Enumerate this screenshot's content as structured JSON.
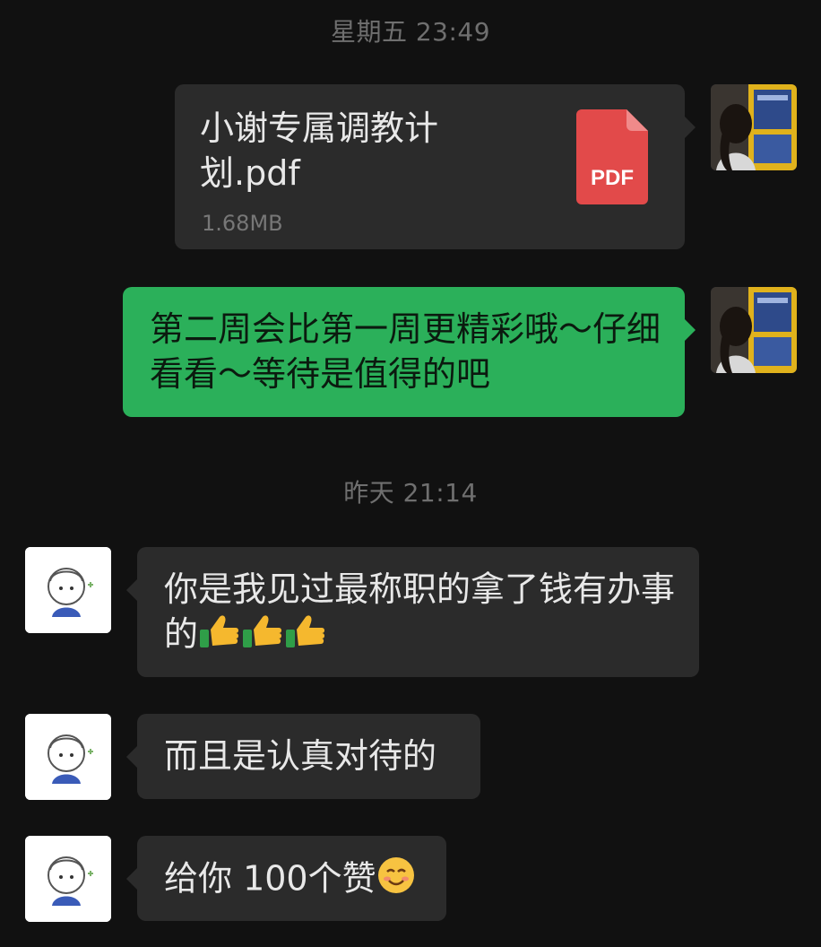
{
  "timestamps": {
    "first": "星期五 23:49",
    "second": "昨天 21:14"
  },
  "messages": {
    "file": {
      "name": "小谢专属调教计划.pdf",
      "size": "1.68MB",
      "type_label": "PDF"
    },
    "green_text": "第二周会比第一周更精彩哦～仔细看看～等待是值得的吧",
    "reply1": "你是我见过最称职的拿了钱有办事的",
    "reply2": "而且是认真对待的",
    "reply3": "给你 100个赞"
  },
  "icons": {
    "thumbs_up": "thumbs-up-emoji",
    "smile": "smiling-face-emoji",
    "pdf": "pdf-file-icon"
  },
  "colors": {
    "background": "#111111",
    "bubble_dark": "#2b2b2b",
    "bubble_green": "#2bb05a",
    "pdf_red": "#e24a4a",
    "timestamp": "#6f6f6f"
  }
}
